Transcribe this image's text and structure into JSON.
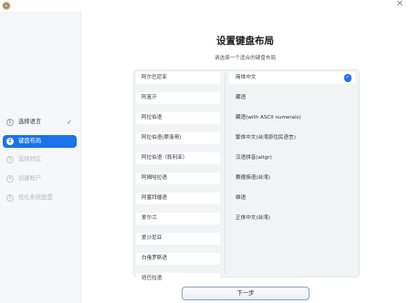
{
  "window": {
    "close_icon": "close-icon",
    "app_icon": "installer-icon"
  },
  "sidebar": {
    "steps": [
      {
        "number": "1",
        "label": "选择语言",
        "state": "done"
      },
      {
        "number": "2",
        "label": "键盘布局",
        "state": "active"
      },
      {
        "number": "3",
        "label": "选择时区",
        "state": "disabled"
      },
      {
        "number": "4",
        "label": "创建帐户",
        "state": "disabled"
      },
      {
        "number": "5",
        "label": "优化系统配置",
        "state": "disabled"
      }
    ]
  },
  "main": {
    "title": "设置键盘布局",
    "subtitle": "请选择一个适合的键盘布局",
    "layouts": [
      "阿尔巴尼亚",
      "阿富汗",
      "阿拉伯语",
      "阿拉伯语(摩洛哥)",
      "阿拉伯语（叙利亚）",
      "阿姆哈拉语",
      "阿塞拜疆语",
      "爱尔兰",
      "爱沙尼亚",
      "白俄罗斯语",
      "班巴拉语"
    ],
    "variants": [
      "简体中文",
      "藏语",
      "藏语(with ASCII numerals)",
      "繁体中文(台湾原住民语言)",
      "汉语拼音(altgr)",
      "赛德族语(台湾)",
      "维语",
      "正体中文(台湾)"
    ],
    "selected_variant": "简体中文",
    "next_button": "下一步"
  },
  "colors": {
    "accent": "#1a73e8",
    "sidebar_bg": "#f5f7fa",
    "panel_bg": "#f2f3f5"
  }
}
